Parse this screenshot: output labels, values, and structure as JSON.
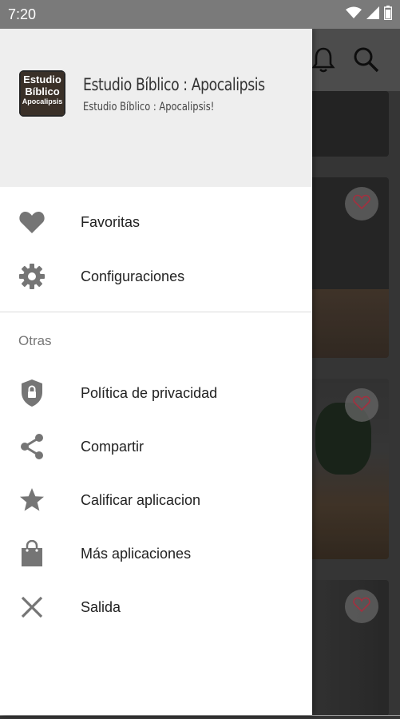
{
  "status_bar": {
    "time": "7:20",
    "icons": [
      "wifi-icon",
      "signal-icon",
      "battery-icon"
    ]
  },
  "background_app": {
    "toolbar_icons": [
      "bell-icon",
      "search-icon"
    ],
    "cards": [
      {
        "favorite_icon": "heart-outline-icon"
      },
      {
        "favorite_icon": "heart-outline-icon"
      },
      {
        "favorite_icon": "heart-outline-icon"
      }
    ]
  },
  "drawer": {
    "header": {
      "logo_text": [
        "Estudio",
        "Bíblico",
        "Apocalipsis"
      ],
      "title": "Estudio Bíblico : Apocalipsis",
      "subtitle": "Estudio Bíblico : Apocalipsis!"
    },
    "primary_items": [
      {
        "icon": "heart-icon",
        "label": "Favoritas"
      },
      {
        "icon": "gear-icon",
        "label": "Configuraciones"
      }
    ],
    "section_label": "Otras",
    "secondary_items": [
      {
        "icon": "shield-lock-icon",
        "label": "Política de privacidad"
      },
      {
        "icon": "share-icon",
        "label": "Compartir"
      },
      {
        "icon": "star-icon",
        "label": "Calificar aplicacion"
      },
      {
        "icon": "shopping-bag-icon",
        "label": "Más aplicaciones"
      },
      {
        "icon": "close-icon",
        "label": "Salida"
      }
    ]
  },
  "colors": {
    "status_bar": "#7a7a7a",
    "drawer_header": "#eeeeee",
    "icon_gray": "#757575",
    "text_primary": "#222222",
    "text_secondary": "#777777"
  }
}
